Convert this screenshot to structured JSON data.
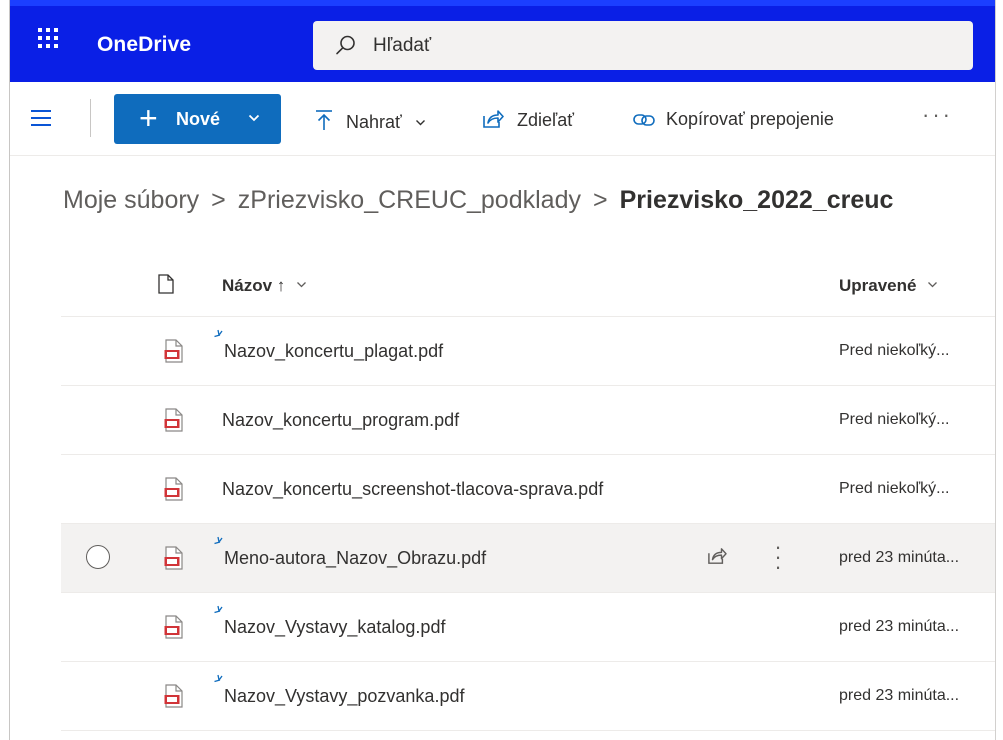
{
  "app": {
    "name": "OneDrive"
  },
  "search": {
    "placeholder": "Hľadať"
  },
  "commands": {
    "new_label": "Nové",
    "upload_label": "Nahrať",
    "share_label": "Zdieľať",
    "copy_link_label": "Kopírovať prepojenie",
    "more_label": "···"
  },
  "breadcrumb": {
    "items": [
      "Moje súbory",
      "zPriezvisko_CREUC_podklady"
    ],
    "current": "Priezvisko_2022_creuc",
    "separator": ">"
  },
  "columns": {
    "name": "Názov ↑",
    "modified": "Upravené"
  },
  "files": [
    {
      "name": "Nazov_koncertu_plagat.pdf",
      "modified": "Pred niekoľký...",
      "new": true
    },
    {
      "name": "Nazov_koncertu_program.pdf",
      "modified": "Pred niekoľký...",
      "new": false
    },
    {
      "name": "Nazov_koncertu_screenshot-tlacova-sprava.pdf",
      "modified": "Pred niekoľký...",
      "new": false
    },
    {
      "name": "Meno-autora_Nazov_Obrazu.pdf",
      "modified": "pred 23 minúta...",
      "new": true,
      "hovered": true
    },
    {
      "name": "Nazov_Vystavy_katalog.pdf",
      "modified": "pred 23 minúta...",
      "new": true
    },
    {
      "name": "Nazov_Vystavy_pozvanka.pdf",
      "modified": "pred 23 minúta...",
      "new": true
    }
  ],
  "colors": {
    "suitebar": "#0a1fe6",
    "accent": "#0f6cbd",
    "pdf_red": "#d13438"
  }
}
